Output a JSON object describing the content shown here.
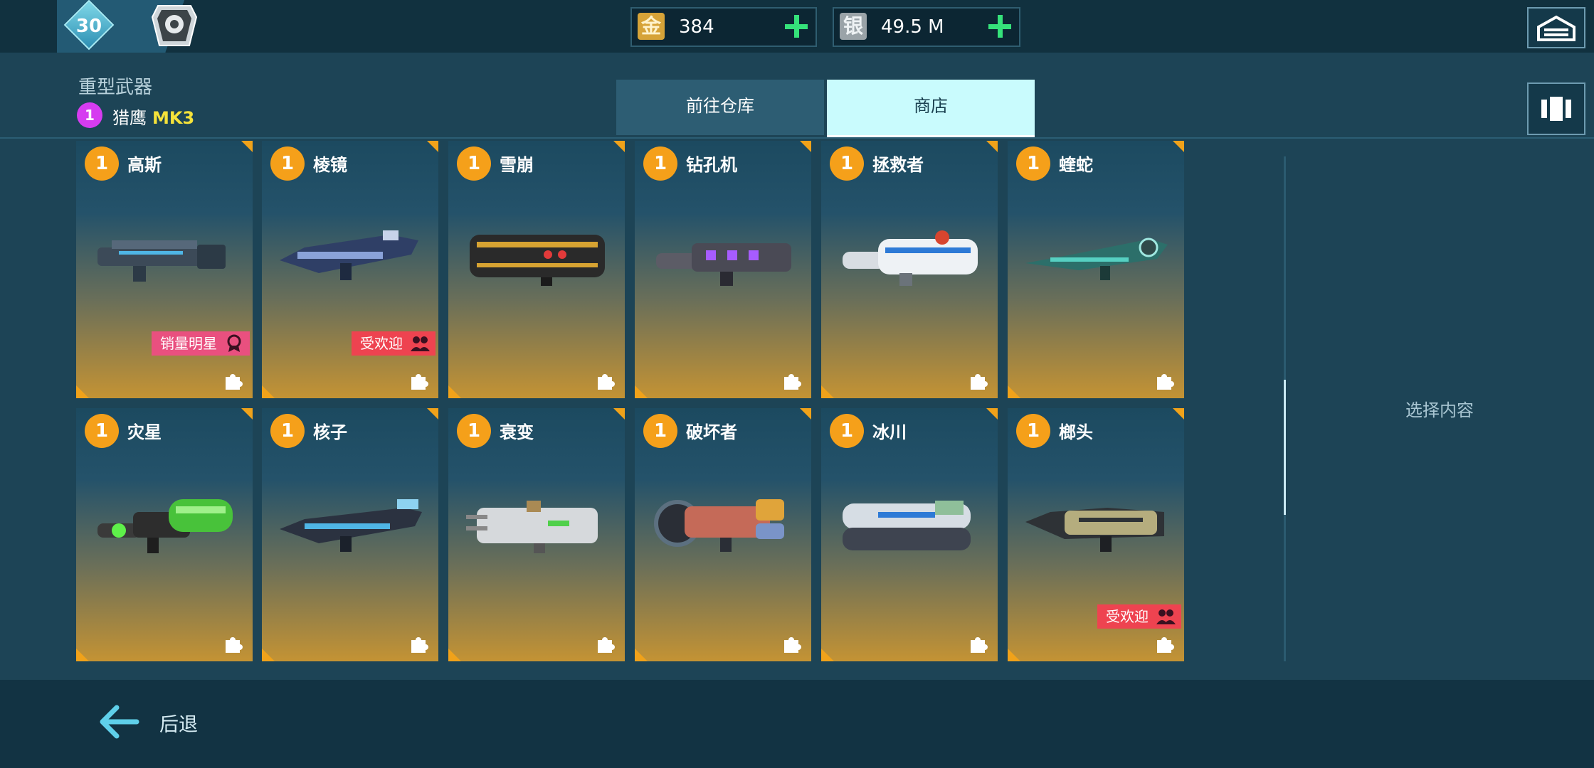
{
  "player": {
    "level": "30"
  },
  "currency": {
    "gold": {
      "icon_char": "金",
      "value": "384"
    },
    "silver": {
      "icon_char": "银",
      "value": "49.5 M"
    }
  },
  "header": {
    "category": "重型武器",
    "slot_badge": "1",
    "slot_weapon": "猎鹰",
    "slot_mk": "MK3"
  },
  "tabs": [
    {
      "label": "前往仓库",
      "active": false
    },
    {
      "label": "商店",
      "active": true
    }
  ],
  "weapons": [
    {
      "badge": "1",
      "name": "高斯",
      "tag": "销量明星"
    },
    {
      "badge": "1",
      "name": "棱镜",
      "tag": "受欢迎"
    },
    {
      "badge": "1",
      "name": "雪崩",
      "tag": ""
    },
    {
      "badge": "1",
      "name": "钻孔机",
      "tag": ""
    },
    {
      "badge": "1",
      "name": "拯救者",
      "tag": ""
    },
    {
      "badge": "1",
      "name": "蝰蛇",
      "tag": ""
    },
    {
      "badge": "1",
      "name": "灾星",
      "tag": ""
    },
    {
      "badge": "1",
      "name": "核子",
      "tag": ""
    },
    {
      "badge": "1",
      "name": "衰变",
      "tag": ""
    },
    {
      "badge": "1",
      "name": "破坏者",
      "tag": ""
    },
    {
      "badge": "1",
      "name": "冰川",
      "tag": ""
    },
    {
      "badge": "1",
      "name": "榔头",
      "tag": "受欢迎"
    }
  ],
  "side_panel": {
    "placeholder": "选择内容"
  },
  "footer": {
    "back_label": "后退"
  },
  "colors": {
    "accent_active_tab": "#c9fbfd",
    "gold_badge": "#f5a01a",
    "plus_green": "#35e27a",
    "slot_badge_purple": "#d63cf0",
    "tag_pink": "#e9507f",
    "tag_red": "#ee4350"
  }
}
